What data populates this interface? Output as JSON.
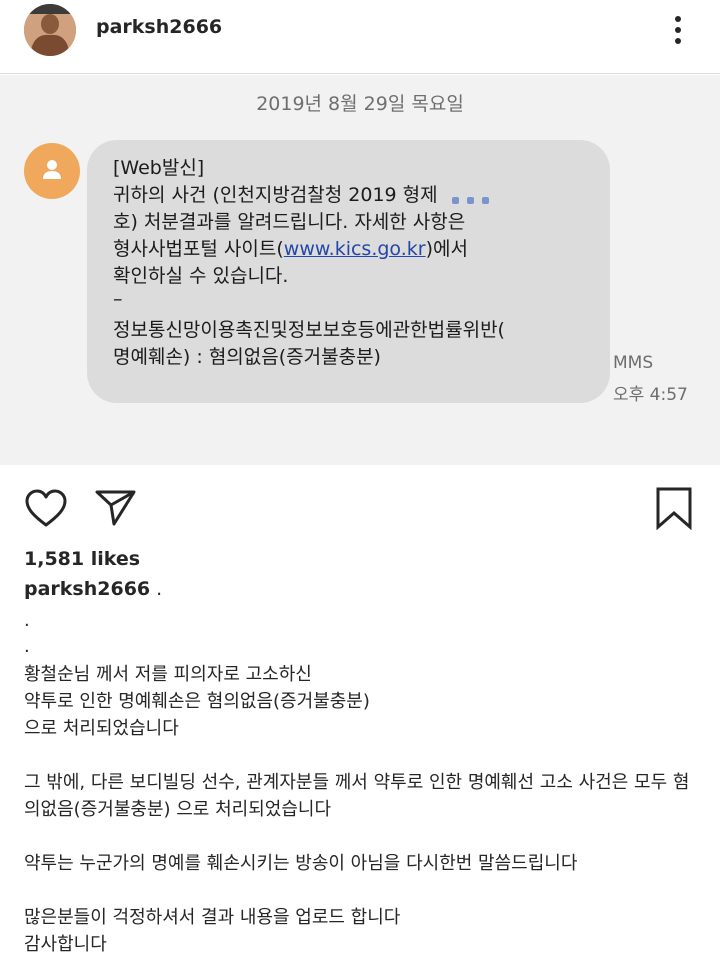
{
  "header": {
    "username": "parksh2666",
    "avatar_icon": "profile-photo-icon",
    "more_icon": "more-options-icon"
  },
  "screenshot": {
    "date": "2019년 8월 29일 목요일",
    "sender_icon": "default-contact-icon",
    "message_lines": [
      "[Web발신]",
      "귀하의 사건 (인천지방검찰청 2019 형제",
      "호) 처분결과를 알려드립니다. 자세한 사항은",
      "형사사법포털 사이트(",
      "확인하실 수 있습니다.",
      "–",
      "정보통신망이용촉진및정보보호등에관한법률위반(",
      "명예훼손) : 혐의없음(증거불충분)"
    ],
    "link": "www.kics.go.kr",
    "link_suffix": ")에서",
    "type": "MMS",
    "time": "오후 4:57",
    "bubble_color": "#dcdcdc",
    "link_color": "#2446a8"
  },
  "actions": {
    "like_icon": "heart-icon",
    "share_icon": "paper-plane-icon",
    "save_icon": "bookmark-icon"
  },
  "post": {
    "likes": "1,581 likes",
    "username": "parksh2666",
    "username_tail": ".",
    "caption_lines": [
      ".",
      ".",
      "황철순님 께서 저를 피의자로 고소하신",
      "약투로 인한 명예훼손은 혐의없음(증거불충분)",
      "으로 처리되었습니다",
      "그 밖에, 다른 보디빌딩 선수, 관계자분들 께서 약투로 인한 명예훼선 고소 사건은 모두 혐",
      "의없음(증거불충분) 으로 처리되었습니다",
      "약투는 누군가의 명예를 훼손시키는 방송이 아님을 다시한번 말씀드립니다",
      "많은분들이 걱정하셔서 결과 내용을 업로드 합니다",
      "감사합니다"
    ]
  }
}
